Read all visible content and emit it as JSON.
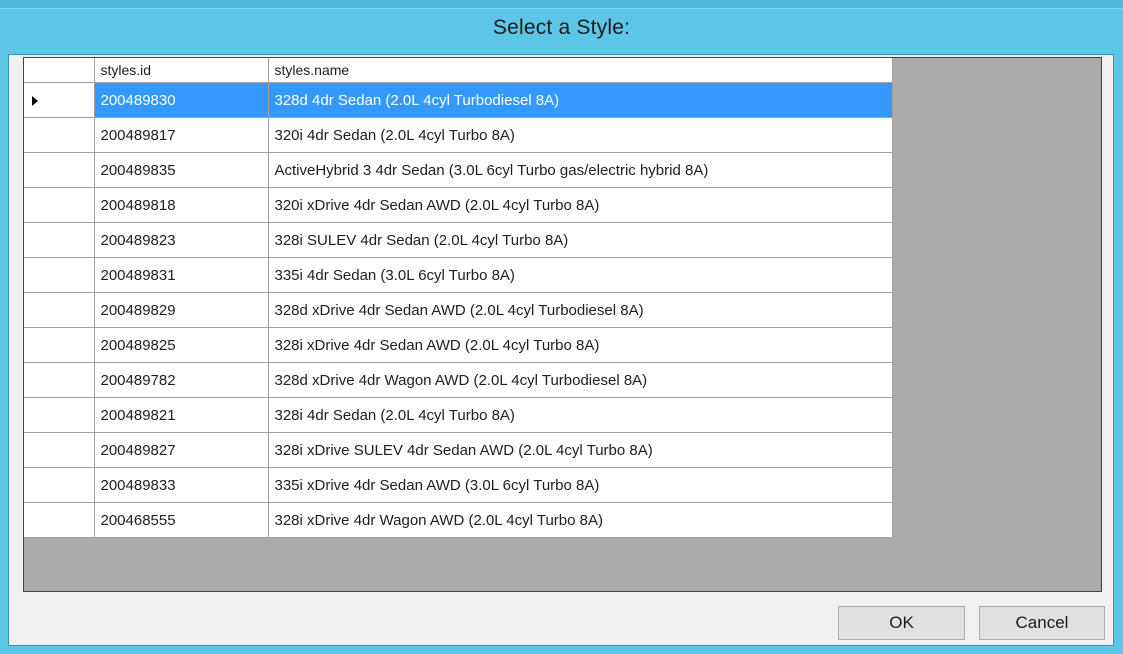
{
  "dialog": {
    "title": "Select a Style:"
  },
  "grid": {
    "columns": [
      "styles.id",
      "styles.name"
    ],
    "selected_index": 0,
    "rows": [
      {
        "id": "200489830",
        "name": "328d 4dr Sedan (2.0L 4cyl Turbodiesel 8A)"
      },
      {
        "id": "200489817",
        "name": "320i 4dr Sedan (2.0L 4cyl Turbo 8A)"
      },
      {
        "id": "200489835",
        "name": "ActiveHybrid 3 4dr Sedan (3.0L 6cyl Turbo gas/electric hybrid 8A)"
      },
      {
        "id": "200489818",
        "name": "320i xDrive 4dr Sedan AWD (2.0L 4cyl Turbo 8A)"
      },
      {
        "id": "200489823",
        "name": "328i SULEV 4dr Sedan (2.0L 4cyl Turbo 8A)"
      },
      {
        "id": "200489831",
        "name": "335i 4dr Sedan (3.0L 6cyl Turbo 8A)"
      },
      {
        "id": "200489829",
        "name": "328d xDrive 4dr Sedan AWD (2.0L 4cyl Turbodiesel 8A)"
      },
      {
        "id": "200489825",
        "name": "328i xDrive 4dr Sedan AWD (2.0L 4cyl Turbo 8A)"
      },
      {
        "id": "200489782",
        "name": "328d xDrive 4dr Wagon AWD (2.0L 4cyl Turbodiesel 8A)"
      },
      {
        "id": "200489821",
        "name": "328i 4dr Sedan (2.0L 4cyl Turbo 8A)"
      },
      {
        "id": "200489827",
        "name": "328i xDrive SULEV 4dr Sedan AWD (2.0L 4cyl Turbo 8A)"
      },
      {
        "id": "200489833",
        "name": "335i xDrive 4dr Sedan AWD (3.0L 6cyl Turbo 8A)"
      },
      {
        "id": "200468555",
        "name": "328i xDrive 4dr Wagon AWD (2.0L 4cyl Turbo 8A)"
      }
    ]
  },
  "buttons": {
    "ok_label": "OK",
    "cancel_label": "Cancel"
  },
  "colors": {
    "frame": "#5dc6e6",
    "selection": "#3399ff",
    "grid_background": "#ababab"
  },
  "icons": {
    "current_row": "row-pointer-icon"
  }
}
